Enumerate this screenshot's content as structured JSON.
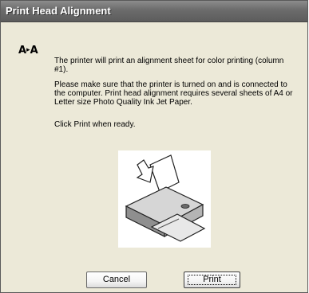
{
  "window": {
    "title": "Print Head Alignment"
  },
  "icon": {
    "name": "font-size-icon",
    "left": "A",
    "right": "A"
  },
  "messages": [
    "The printer will print an alignment sheet for color printing (column #1).",
    "Please make sure that the printer is turned on and is connected to the computer. Print head alignment requires several sheets of A4 or Letter size Photo Quality Ink Jet Paper.",
    "Click Print when ready."
  ],
  "illustration": {
    "name": "printer-with-paper-illustration"
  },
  "buttons": {
    "cancel": "Cancel",
    "print": "Print"
  }
}
